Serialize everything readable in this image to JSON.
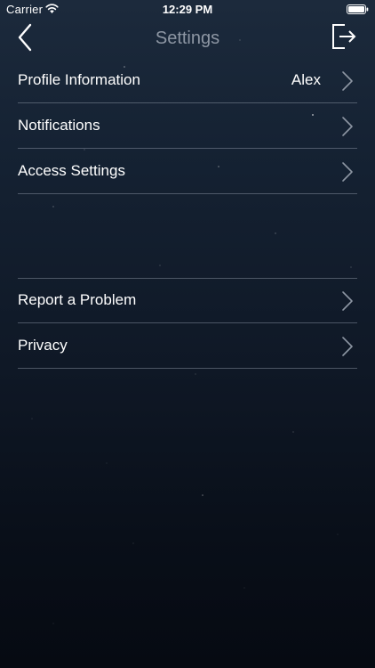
{
  "status_bar": {
    "carrier": "Carrier",
    "time": "12:29 PM",
    "wifi_icon": "wifi-icon",
    "battery_icon": "battery-icon"
  },
  "nav": {
    "title": "Settings",
    "back_icon": "chevron-left-icon",
    "logout_icon": "logout-icon"
  },
  "settings": {
    "sections": [
      {
        "items": [
          {
            "label": "Profile Information",
            "value": "Alex"
          },
          {
            "label": "Notifications"
          },
          {
            "label": "Access Settings"
          }
        ]
      },
      {
        "items": [
          {
            "label": "Report a Problem"
          },
          {
            "label": "Privacy"
          }
        ]
      }
    ]
  },
  "colors": {
    "title": "#8d96a3",
    "text": "#ffffff",
    "separator": "#969faf",
    "background_top": "#1c2a3c",
    "background_bottom": "#060a12"
  }
}
